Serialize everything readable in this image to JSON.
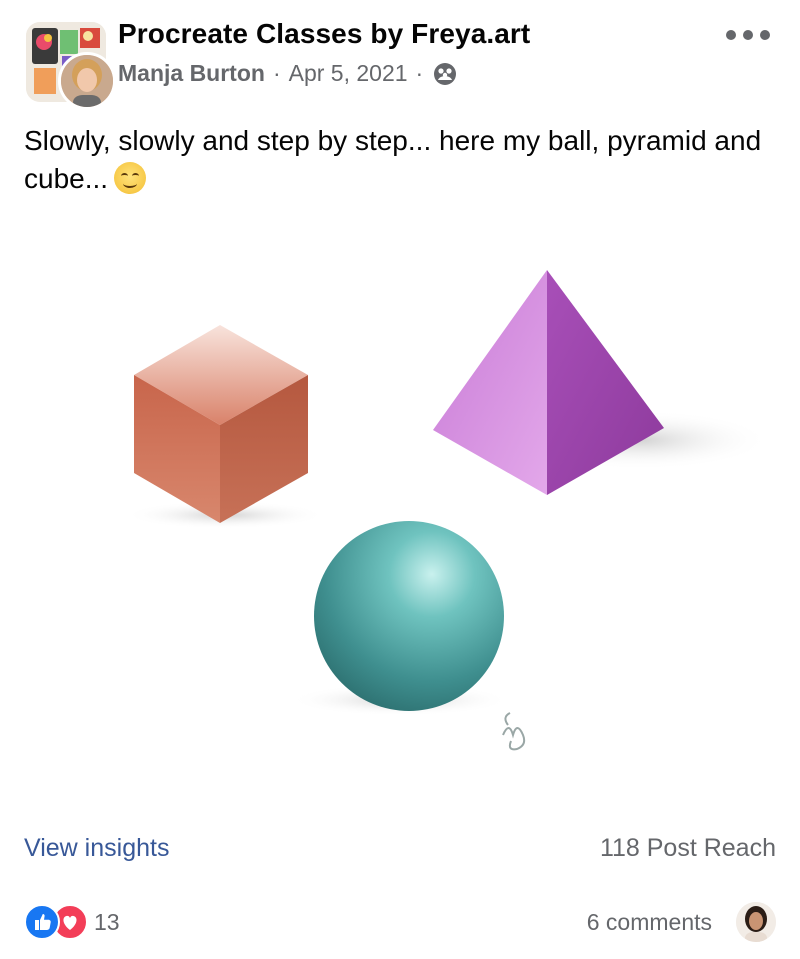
{
  "post": {
    "group_name": "Procreate Classes by Freya.art",
    "author": "Manja Burton",
    "separator": "·",
    "date": "Apr 5, 2021",
    "text": "Slowly, slowly and step by step... here my ball, pyramid and cube...",
    "emoji": "smiling-face-emoji"
  },
  "footer": {
    "view_insights": "View insights",
    "reach": "118 Post Reach",
    "reaction_count": "13",
    "comments": "6 comments"
  },
  "icons": {
    "more": "more-options-icon",
    "privacy": "members-icon",
    "like": "like-reaction-icon",
    "love": "love-reaction-icon"
  },
  "colors": {
    "link": "#385898",
    "secondary_text": "#65676b",
    "like_blue": "#1877f2",
    "love_red": "#f33e58",
    "cube": "#c7654a",
    "pyramid": "#b55ec4",
    "sphere": "#4a9d9d"
  }
}
